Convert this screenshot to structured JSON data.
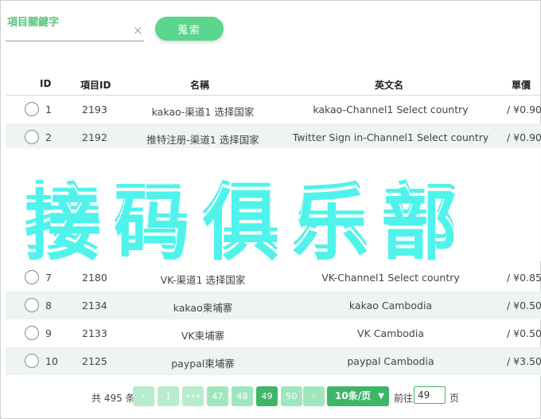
{
  "search": {
    "label": "項目關鍵字",
    "clear_icon": "×",
    "button_label": "蒐索"
  },
  "table": {
    "headers": [
      "ID",
      "項目ID",
      "名稱",
      "英文名",
      "單價"
    ],
    "rows": [
      {
        "id": "1",
        "pid": "2193",
        "name": "kakao-渠道1 选择国家",
        "en": "kakao-Channel1 Select country",
        "price": "/ ¥0.90"
      },
      {
        "id": "2",
        "pid": "2192",
        "name": "推特注册-渠道1 选择国家",
        "en": "Twitter Sign in-Channel1 Select country",
        "price": "/ ¥0.90"
      },
      {
        "id": "7",
        "pid": "2180",
        "name": "VK-渠道1 选择国家",
        "en": "VK-Channel1 Select country",
        "price": "/ ¥0.85"
      },
      {
        "id": "8",
        "pid": "2134",
        "name": "kakao柬埔寨",
        "en": "kakao Cambodia",
        "price": "/ ¥0.50"
      },
      {
        "id": "9",
        "pid": "2133",
        "name": "VK柬埔寨",
        "en": "VK Cambodia",
        "price": "/ ¥0.50"
      },
      {
        "id": "10",
        "pid": "2125",
        "name": "paypal柬埔寨",
        "en": "paypal Cambodia",
        "price": "/ ¥3.50"
      }
    ]
  },
  "watermark": "接码俱乐部",
  "pagination": {
    "total_text": "共 495 条",
    "prev_icon": "‹",
    "next_icon": "›",
    "pages": [
      "1",
      "•••",
      "47",
      "48",
      "49",
      "50"
    ],
    "active_page": "49",
    "page_size": "10条/页",
    "page_size_arrow": "▼",
    "goto_label": "前往",
    "goto_value": "49",
    "goto_suffix": "页"
  },
  "colors": {
    "accent": "#3fb56a",
    "accent_light": "#9fe6bd",
    "watermark": "#4ff3ec"
  }
}
